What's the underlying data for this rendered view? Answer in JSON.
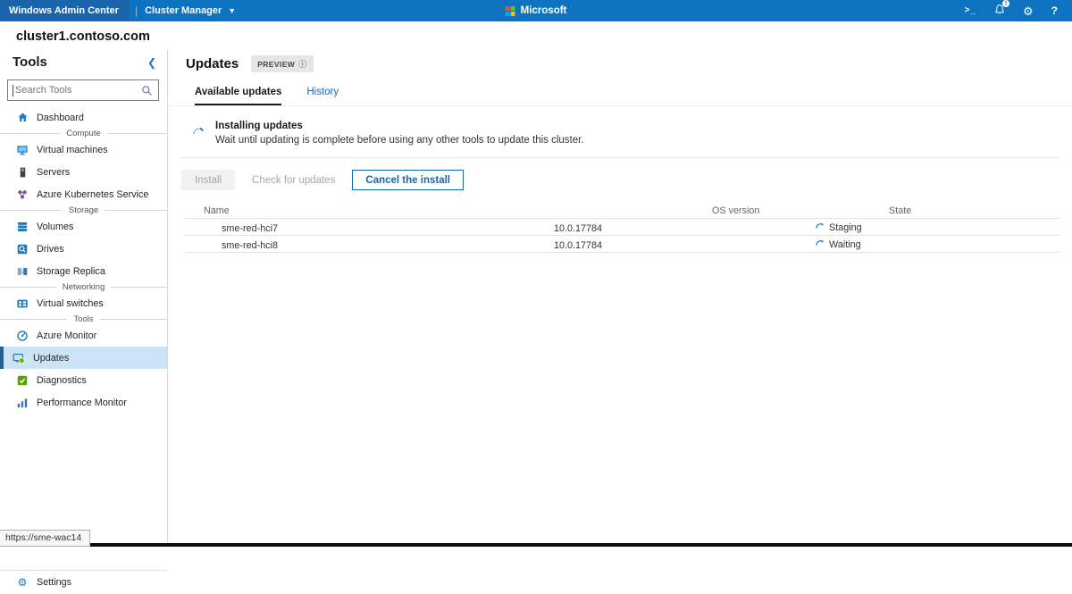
{
  "topbar": {
    "app_title": "Windows Admin Center",
    "separator": "|",
    "solution": "Cluster Manager",
    "brand": "Microsoft",
    "right_icons": [
      "powershell-console-icon",
      "notifications-bell-icon",
      "settings-gear-icon",
      "help-icon"
    ],
    "notification_badge": "!"
  },
  "cluster_name": "cluster1.contoso.com",
  "sidebar": {
    "title": "Tools",
    "collapse_chevron": "❮",
    "search_placeholder": "Search Tools",
    "items": [
      {
        "type": "item",
        "label": "Dashboard",
        "icon": "dashboard-home"
      },
      {
        "type": "separator",
        "label": "Compute"
      },
      {
        "type": "item",
        "label": "Virtual machines",
        "icon": "virtual-machines"
      },
      {
        "type": "item",
        "label": "Servers",
        "icon": "servers"
      },
      {
        "type": "item",
        "label": "Azure Kubernetes Service",
        "icon": "azure-kubernetes"
      },
      {
        "type": "separator",
        "label": "Storage"
      },
      {
        "type": "item",
        "label": "Volumes",
        "icon": "volumes"
      },
      {
        "type": "item",
        "label": "Drives",
        "icon": "drives"
      },
      {
        "type": "item",
        "label": "Storage Replica",
        "icon": "storage-replica"
      },
      {
        "type": "separator",
        "label": "Networking"
      },
      {
        "type": "item",
        "label": "Virtual switches",
        "icon": "virtual-switches"
      },
      {
        "type": "separator",
        "label": "Tools"
      },
      {
        "type": "item",
        "label": "Azure Monitor",
        "icon": "azure-monitor"
      },
      {
        "type": "item",
        "label": "Updates",
        "icon": "updates",
        "selected": true
      },
      {
        "type": "item",
        "label": "Diagnostics",
        "icon": "diagnostics"
      },
      {
        "type": "item",
        "label": "Performance Monitor",
        "icon": "performance-monitor"
      }
    ],
    "bottom_item": {
      "label": "Settings",
      "icon": "settings-gear"
    }
  },
  "main": {
    "title": "Updates",
    "preview_badge": "PREVIEW",
    "preview_info_glyph": "ⓘ",
    "tabs": [
      {
        "label": "Available updates",
        "active": true
      },
      {
        "label": "History",
        "active": false
      }
    ],
    "notice": {
      "title": "Installing updates",
      "description": "Wait until updating is complete before using any other tools to update this cluster."
    },
    "buttons": [
      {
        "label": "Install",
        "state": "disabled-filled"
      },
      {
        "label": "Check for updates",
        "state": "disabled-plain"
      },
      {
        "label": "Cancel the install",
        "state": "primary-outline"
      }
    ],
    "table": {
      "columns": [
        "Name",
        "OS version",
        "State"
      ],
      "rows": [
        {
          "name": "sme-red-hci7",
          "os_version": "10.0.17784",
          "state": "Staging"
        },
        {
          "name": "sme-red-hci8",
          "os_version": "10.0.17784",
          "state": "Waiting"
        }
      ]
    }
  },
  "status_tooltip": "https://sme-wac14",
  "colors": {
    "topbar": "#0d73c1",
    "topbar_app_segment": "#1a64ab",
    "accent_blue": "#0f6cbd",
    "selected_item_bg": "#cde4f6",
    "selected_item_border": "#21609b",
    "disabled_text": "#a6a6a6",
    "disabled_bg": "#f2f2f2",
    "diagnostics_green": "#57a300",
    "updates_green_dot": "#6bb700",
    "aks_purple": "#7f4fa8",
    "ms_logo": [
      "#f25022",
      "#7fba00",
      "#00a4ef",
      "#ffb900"
    ]
  }
}
